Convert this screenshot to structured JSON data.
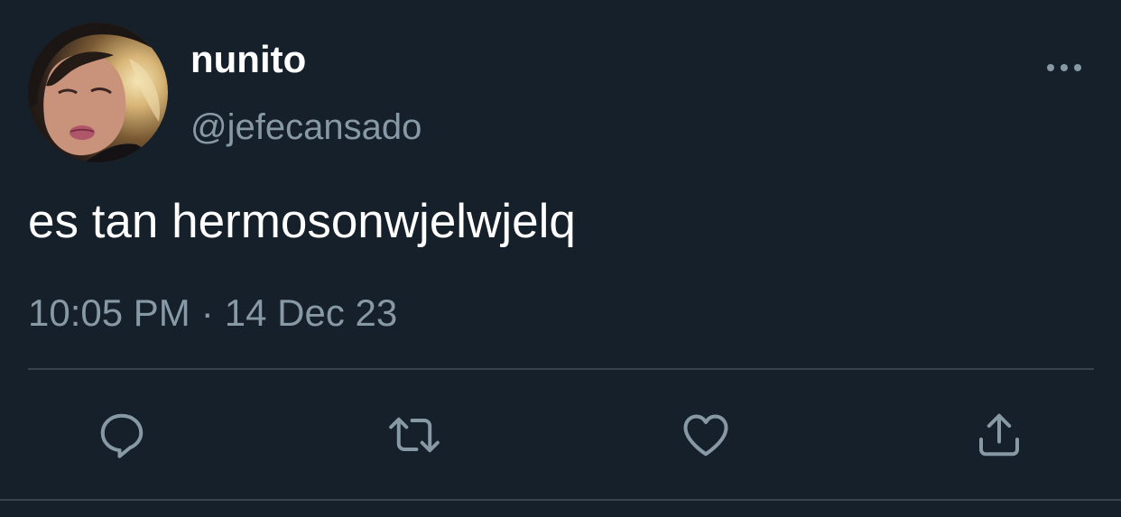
{
  "tweet": {
    "author": {
      "display_name": "nunito",
      "handle": "@jefecansado",
      "avatar_icon": "profile-photo"
    },
    "text": "es tan hermosonwjelwjelq",
    "time": "10:05 PM",
    "separator": "·",
    "date": "14 Dec 23"
  },
  "actions": {
    "more_icon": "ellipsis-icon",
    "reply_icon": "reply-icon",
    "retweet_icon": "retweet-icon",
    "like_icon": "heart-icon",
    "share_icon": "share-icon"
  },
  "colors": {
    "background": "#15202b",
    "primary_text": "#ffffff",
    "secondary_text": "#8899a6",
    "divider": "#38444d"
  }
}
